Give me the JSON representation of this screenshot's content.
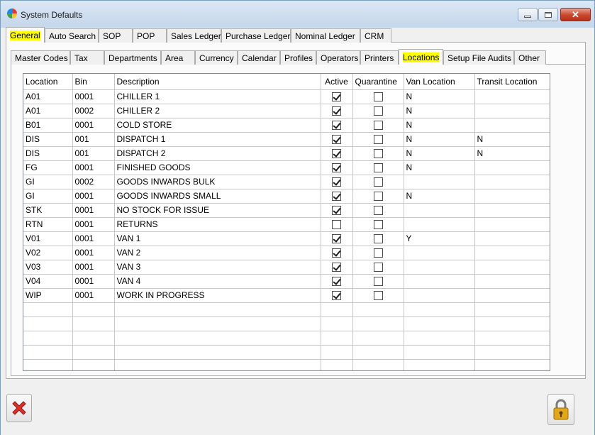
{
  "window": {
    "title": "System Defaults"
  },
  "top_tabs": [
    "General",
    "Auto Search",
    "SOP",
    "POP",
    "Sales Ledger",
    "Purchase Ledger",
    "Nominal Ledger",
    "CRM"
  ],
  "sub_tabs": [
    "Master Codes",
    "Tax",
    "Departments",
    "Area",
    "Currency",
    "Calendar",
    "Profiles",
    "Operators",
    "Printers",
    "Locations",
    "Setup File Audits",
    "Other"
  ],
  "grid": {
    "headers": [
      "Location",
      "Bin",
      "Description",
      "Active",
      "Quarantine",
      "Van Location",
      "Transit Location"
    ],
    "rows": [
      [
        "A01",
        "0001",
        "CHILLER 1",
        true,
        false,
        "N",
        ""
      ],
      [
        "A01",
        "0002",
        "CHILLER 2",
        true,
        false,
        "N",
        ""
      ],
      [
        "B01",
        "0001",
        "COLD STORE",
        true,
        false,
        "N",
        ""
      ],
      [
        "DIS",
        "001",
        "DISPATCH 1",
        true,
        false,
        "N",
        "N"
      ],
      [
        "DIS",
        "001",
        "DISPATCH 2",
        true,
        false,
        "N",
        "N"
      ],
      [
        "FG",
        "0001",
        "FINISHED GOODS",
        true,
        false,
        "N",
        ""
      ],
      [
        "GI",
        "0002",
        "GOODS INWARDS BULK",
        true,
        false,
        "",
        ""
      ],
      [
        "GI",
        "0001",
        "GOODS INWARDS SMALL",
        true,
        false,
        "N",
        ""
      ],
      [
        "STK",
        "0001",
        "NO STOCK FOR ISSUE",
        true,
        false,
        "",
        ""
      ],
      [
        "RTN",
        "0001",
        "RETURNS",
        false,
        false,
        "",
        ""
      ],
      [
        "V01",
        "0001",
        "VAN 1",
        true,
        false,
        "Y",
        ""
      ],
      [
        "V02",
        "0001",
        "VAN 2",
        true,
        false,
        "",
        ""
      ],
      [
        "V03",
        "0001",
        "VAN 3",
        true,
        false,
        "",
        ""
      ],
      [
        "V04",
        "0001",
        "VAN 4",
        true,
        false,
        "",
        ""
      ],
      [
        "WIP",
        "0001",
        "WORK IN PROGRESS",
        true,
        false,
        "",
        ""
      ]
    ],
    "empty_rows": 5
  },
  "icons": {
    "cancel": "red-x-icon",
    "lock": "padlock-icon"
  },
  "colors": {
    "highlight": "#ffff00",
    "cancel_red": "#d9322b",
    "lock_gold": "#e2a81a"
  }
}
